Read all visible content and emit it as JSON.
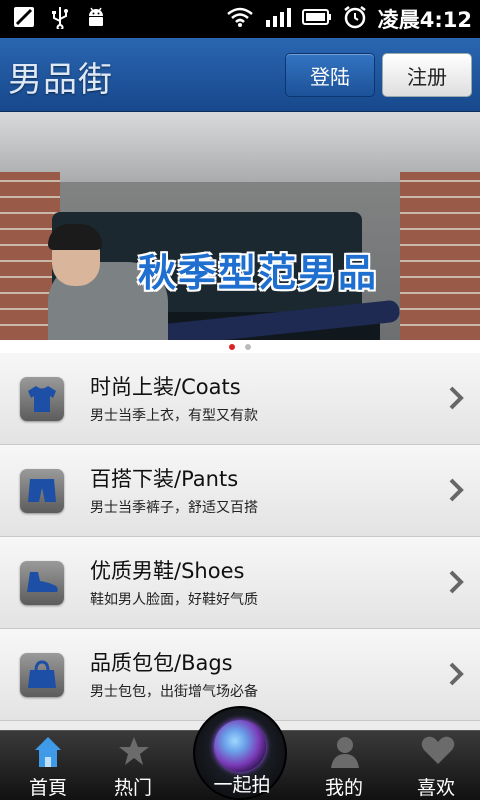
{
  "status_bar": {
    "time": "凌晨4:12"
  },
  "header": {
    "logo": "男品街",
    "login_label": "登陆",
    "register_label": "注册"
  },
  "banner": {
    "title": "秋季型范男品",
    "active_slide": 1,
    "slide_count": 2
  },
  "categories": [
    {
      "title": "时尚上装/Coats",
      "subtitle": "男士当季上衣，有型又有款",
      "icon": "shirt-icon"
    },
    {
      "title": "百搭下装/Pants",
      "subtitle": "男士当季裤子，舒适又百搭",
      "icon": "shorts-icon"
    },
    {
      "title": "优质男鞋/Shoes",
      "subtitle": "鞋如男人脸面，好鞋好气质",
      "icon": "shoe-icon"
    },
    {
      "title": "品质包包/Bags",
      "subtitle": "男士包包，出街增气场必备",
      "icon": "bag-icon"
    }
  ],
  "tabbar": {
    "home": "首頁",
    "hot": "热门",
    "shoot": "一起拍",
    "mine": "我的",
    "favorites": "喜欢",
    "active": "home"
  },
  "colors": {
    "header": "#1f57a0",
    "accent_blue": "#1e6fcf",
    "tab_active": "#3f9be8"
  }
}
